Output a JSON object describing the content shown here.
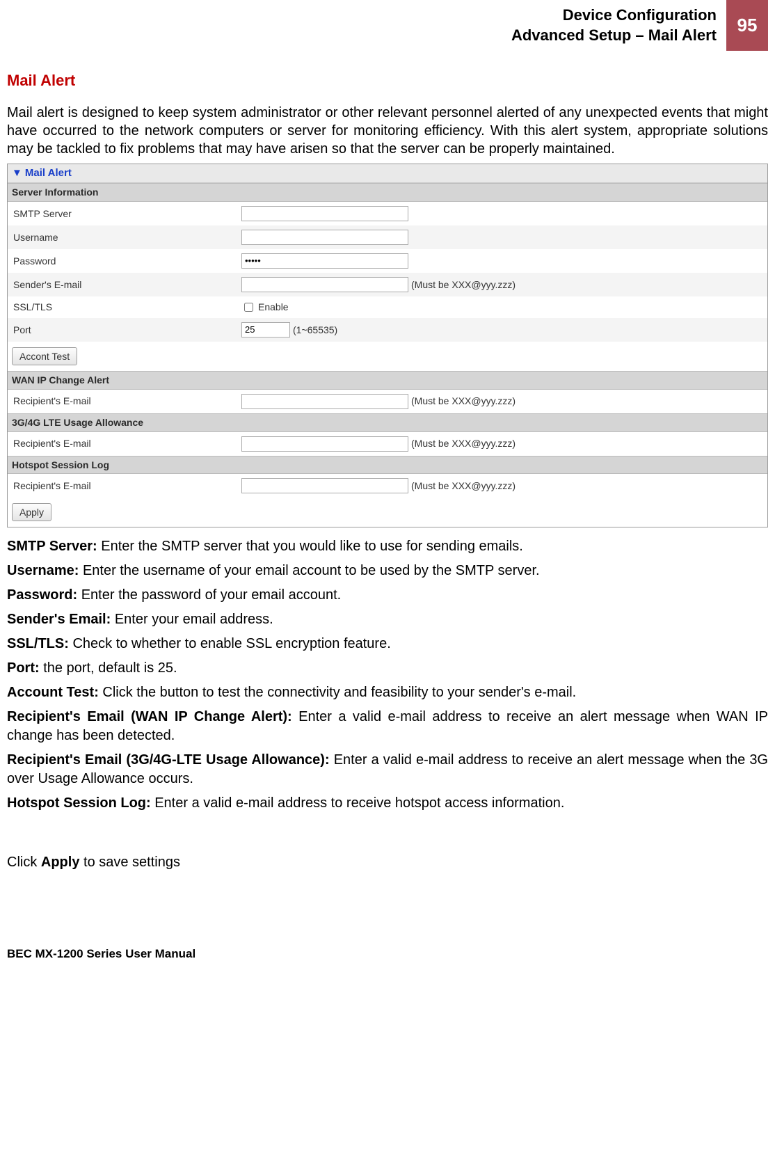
{
  "header": {
    "line1": "Device Configuration",
    "line2": "Advanced Setup – Mail Alert",
    "page_num": "95"
  },
  "section_title": "Mail Alert",
  "intro": "Mail alert is designed to keep system administrator or other relevant personnel alerted of any unexpected events that might have occurred to the network computers or server for monitoring efficiency. With this alert system, appropriate solutions may be tackled to fix problems that may have arisen so that the server can be properly maintained.",
  "panel": {
    "title": "Mail Alert",
    "server_info_head": "Server Information",
    "smtp_label": "SMTP Server",
    "smtp_value": "",
    "user_label": "Username",
    "user_value": "",
    "pass_label": "Password",
    "pass_value": "•••••",
    "sender_label": "Sender's E-mail",
    "sender_value": "",
    "sender_hint": "(Must be XXX@yyy.zzz)",
    "ssl_label": "SSL/TLS",
    "ssl_checkbox_label": "Enable",
    "port_label": "Port",
    "port_value": "25",
    "port_hint": "(1~65535)",
    "account_test_btn": "Accont Test",
    "wan_head": "WAN IP Change Alert",
    "wan_recipient_label": "Recipient's E-mail",
    "wan_recipient_value": "",
    "wan_recipient_hint": "(Must be XXX@yyy.zzz)",
    "lte_head": "3G/4G LTE Usage Allowance",
    "lte_recipient_label": "Recipient's E-mail",
    "lte_recipient_value": "",
    "lte_recipient_hint": "(Must be XXX@yyy.zzz)",
    "hotspot_head": "Hotspot Session Log",
    "hotspot_recipient_label": "Recipient's E-mail",
    "hotspot_recipient_value": "",
    "hotspot_recipient_hint": "(Must be XXX@yyy.zzz)",
    "apply_btn": "Apply"
  },
  "descriptions": {
    "smtp_b": "SMTP Server: ",
    "smtp_t": "Enter the SMTP server that you would like to use for sending emails.",
    "user_b": "Username: ",
    "user_t": "Enter the username of your email account to be used by the SMTP server.",
    "pass_b": "Password: ",
    "pass_t": "Enter the password of your email account.",
    "sender_b": "Sender's Email: ",
    "sender_t": "Enter your email address.",
    "ssl_b": "SSL/TLS: ",
    "ssl_t": "Check to whether to enable SSL encryption feature.",
    "port_b": "Port: ",
    "port_t": "the port, default is 25.",
    "acct_b": "Account Test: ",
    "acct_t": "Click the button to test the connectivity and feasibility to your sender's e-mail.",
    "wan_b": "Recipient's Email (WAN IP Change Alert): ",
    "wan_t": "Enter a valid e-mail address to receive an alert message when WAN IP change has been detected.",
    "lte_b": "Recipient's Email (3G/4G-LTE Usage Allowance): ",
    "lte_t": "Enter a valid e-mail address to receive an alert message when the 3G over Usage Allowance occurs.",
    "hot_b": "Hotspot Session Log: ",
    "hot_t": "Enter a valid e-mail address to receive hotspot access information."
  },
  "apply_line_pre": "Click ",
  "apply_line_b": "Apply",
  "apply_line_post": " to save settings",
  "footer": "BEC MX-1200 Series User Manual"
}
